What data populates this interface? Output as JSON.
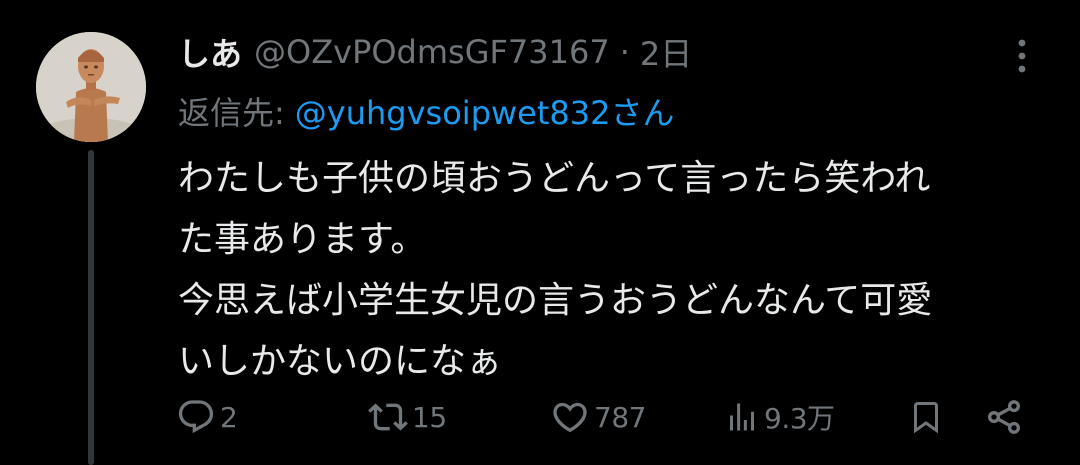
{
  "tweet": {
    "display_name": "しあ",
    "handle": "@OZvPOdmsGF73167",
    "separator": "·",
    "time": "2日",
    "reply_label": "返信先:",
    "reply_to": "@yuhgvsoipwet832さん",
    "body_lines": [
      "わたしも子供の頃おうどんって言ったら笑われ",
      "た事あります。",
      "今思えば小学生女児の言うおうどんなんて可愛",
      "いしかないのになぁ"
    ],
    "avatar_icon": "figurine-avatar"
  },
  "actions": {
    "reply_count": "2",
    "retweet_count": "15",
    "like_count": "787",
    "view_count": "9.3万"
  },
  "icons": {
    "more": "more-vertical-icon",
    "reply": "reply-icon",
    "retweet": "retweet-icon",
    "like": "heart-icon",
    "views": "views-icon",
    "bookmark": "bookmark-icon",
    "share": "share-icon"
  },
  "colors": {
    "background": "#000000",
    "text": "#e7e9ea",
    "muted": "#71767b",
    "link": "#1d9bf0",
    "thread_line": "#333639"
  }
}
